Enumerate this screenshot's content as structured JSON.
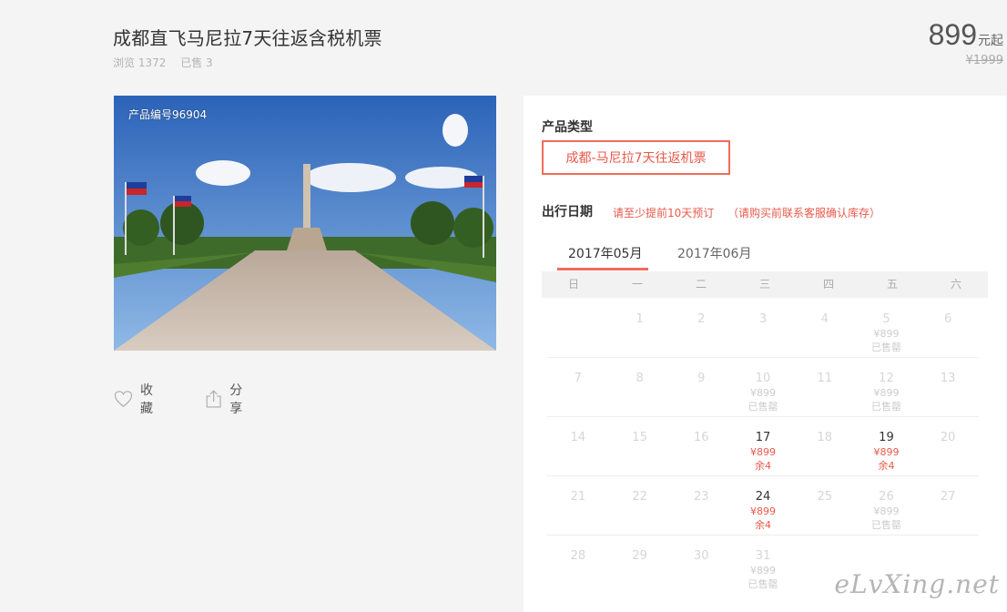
{
  "product": {
    "title": "成都直飞马尼拉7天往返含税机票",
    "views": "浏览 1372",
    "sold": "已售 3",
    "price": "899",
    "price_suffix": "元起",
    "original_price": "¥1999",
    "code": "产品编号96904"
  },
  "actions": {
    "favorite": "收藏",
    "share": "分享"
  },
  "booking": {
    "type_label": "产品类型",
    "type_option": "成都-马尼拉7天往返机票",
    "date_label": "出行日期",
    "note1": "请至少提前10天预订",
    "note2": "（请购买前联系客服确认库存）",
    "tabs": [
      "2017年05月",
      "2017年06月"
    ],
    "weekdays": [
      "日",
      "一",
      "二",
      "三",
      "四",
      "五",
      "六"
    ]
  },
  "calendar": [
    [
      {
        "day": "",
        "price": "",
        "status": ""
      },
      {
        "day": "1",
        "price": "",
        "status": ""
      },
      {
        "day": "2",
        "price": "",
        "status": ""
      },
      {
        "day": "3",
        "price": "",
        "status": ""
      },
      {
        "day": "4",
        "price": "",
        "status": ""
      },
      {
        "day": "5",
        "price": "¥899",
        "status": "已售罄"
      },
      {
        "day": "6",
        "price": "",
        "status": ""
      }
    ],
    [
      {
        "day": "7",
        "price": "",
        "status": ""
      },
      {
        "day": "8",
        "price": "",
        "status": ""
      },
      {
        "day": "9",
        "price": "",
        "status": ""
      },
      {
        "day": "10",
        "price": "¥899",
        "status": "已售罄"
      },
      {
        "day": "11",
        "price": "",
        "status": ""
      },
      {
        "day": "12",
        "price": "¥899",
        "status": "已售罄"
      },
      {
        "day": "13",
        "price": "",
        "status": ""
      }
    ],
    [
      {
        "day": "14",
        "price": "",
        "status": ""
      },
      {
        "day": "15",
        "price": "",
        "status": ""
      },
      {
        "day": "16",
        "price": "",
        "status": ""
      },
      {
        "day": "17",
        "price": "¥899",
        "status": "余4",
        "active": true
      },
      {
        "day": "18",
        "price": "",
        "status": ""
      },
      {
        "day": "19",
        "price": "¥899",
        "status": "余4",
        "active": true
      },
      {
        "day": "20",
        "price": "",
        "status": ""
      }
    ],
    [
      {
        "day": "21",
        "price": "",
        "status": ""
      },
      {
        "day": "22",
        "price": "",
        "status": ""
      },
      {
        "day": "23",
        "price": "",
        "status": ""
      },
      {
        "day": "24",
        "price": "¥899",
        "status": "余4",
        "active": true
      },
      {
        "day": "25",
        "price": "",
        "status": ""
      },
      {
        "day": "26",
        "price": "¥899",
        "status": "已售罄"
      },
      {
        "day": "27",
        "price": "",
        "status": ""
      }
    ],
    [
      {
        "day": "28",
        "price": "",
        "status": ""
      },
      {
        "day": "29",
        "price": "",
        "status": ""
      },
      {
        "day": "30",
        "price": "",
        "status": ""
      },
      {
        "day": "31",
        "price": "¥899",
        "status": "已售罄"
      },
      {
        "day": "",
        "price": "",
        "status": ""
      },
      {
        "day": "",
        "price": "",
        "status": ""
      },
      {
        "day": "",
        "price": "",
        "status": ""
      }
    ]
  ],
  "watermark": "eLvXing.net",
  "colors": {
    "accent": "#f06c5a",
    "accent_text": "#e8594a"
  }
}
